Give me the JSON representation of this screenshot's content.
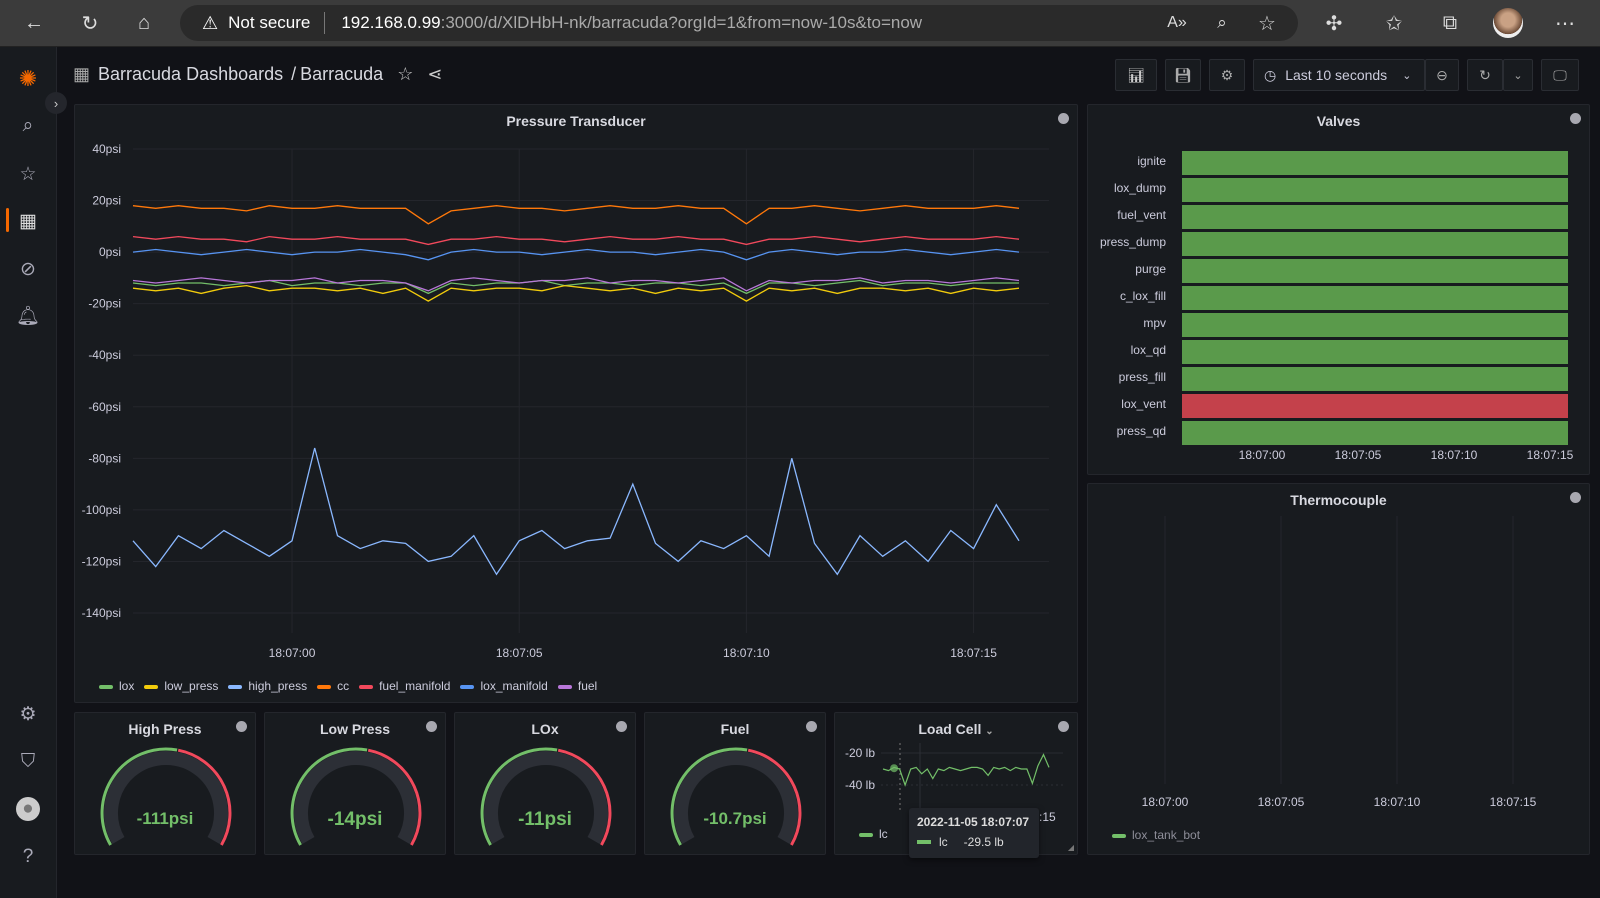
{
  "browser": {
    "security": "Not secure",
    "url_host": "192.168.0.99",
    "url_path": ":3000/d/XlDHbH-nk/barracuda?orgId=1&from=now-10s&to=now"
  },
  "nav": {
    "breadcrumb_folder": "Barracuda Dashboards",
    "breadcrumb_sep": "/",
    "dashboard": "Barracuda",
    "time_range": "Last 10 seconds"
  },
  "colors": {
    "lox": "#73bf69",
    "low_press": "#f2cc0c",
    "high_press": "#8ab8ff",
    "cc": "#ff780a",
    "fuel_manifold": "#f2495c",
    "lox_manifold": "#5794f2",
    "fuel": "#b877d9",
    "valve_open": "#5a9a4b",
    "valve_closed": "#c4414b"
  },
  "pressure": {
    "title": "Pressure Transducer",
    "chart_data": {
      "type": "line",
      "ylim": [
        -140,
        40
      ],
      "yticks": [
        "40psi",
        "20psi",
        "0psi",
        "-20psi",
        "-40psi",
        "-60psi",
        "-80psi",
        "-100psi",
        "-120psi",
        "-140psi"
      ],
      "xticks": [
        "18:07:00",
        "18:07:05",
        "18:07:10",
        "18:07:15"
      ],
      "x": [
        "18:06:56.5",
        "18:06:57.0",
        "18:06:57.5",
        "18:06:58.0",
        "18:06:58.5",
        "18:06:59.0",
        "18:06:59.5",
        "18:07:00.0",
        "18:07:00.5",
        "18:07:01.0",
        "18:07:01.5",
        "18:07:02.0",
        "18:07:02.5",
        "18:07:03.0",
        "18:07:03.5",
        "18:07:04.0",
        "18:07:04.5",
        "18:07:05.0",
        "18:07:05.5",
        "18:07:06.0",
        "18:07:06.5",
        "18:07:07.0",
        "18:07:07.5",
        "18:07:08.0",
        "18:07:08.5",
        "18:07:09.0",
        "18:07:09.5",
        "18:07:10.0",
        "18:07:10.5",
        "18:07:11.0",
        "18:07:11.5",
        "18:07:12.0",
        "18:07:12.5",
        "18:07:13.0",
        "18:07:13.5",
        "18:07:14.0",
        "18:07:14.5",
        "18:07:15.0",
        "18:07:15.5",
        "18:07:16.0"
      ],
      "series": [
        {
          "name": "lox",
          "values": [
            -12,
            -13,
            -12,
            -12,
            -13,
            -12,
            -11,
            -13,
            -12,
            -12,
            -13,
            -12,
            -12,
            -16,
            -12,
            -13,
            -12,
            -12,
            -11,
            -13,
            -12,
            -12,
            -13,
            -12,
            -12,
            -13,
            -12,
            -16,
            -12,
            -12,
            -13,
            -12,
            -11,
            -13,
            -12,
            -12,
            -13,
            -12,
            -12,
            -12
          ]
        },
        {
          "name": "low_press",
          "values": [
            -14,
            -15,
            -14,
            -16,
            -14,
            -13,
            -15,
            -14,
            -14,
            -15,
            -14,
            -16,
            -14,
            -19,
            -14,
            -15,
            -14,
            -14,
            -15,
            -13,
            -14,
            -15,
            -14,
            -16,
            -14,
            -15,
            -14,
            -19,
            -14,
            -15,
            -14,
            -16,
            -14,
            -14,
            -15,
            -14,
            -16,
            -14,
            -15,
            -14
          ]
        },
        {
          "name": "high_press",
          "values": [
            -112,
            -122,
            -110,
            -115,
            -108,
            -113,
            -118,
            -112,
            -76,
            -110,
            -115,
            -112,
            -113,
            -120,
            -118,
            -110,
            -125,
            -112,
            -108,
            -115,
            -112,
            -111,
            -90,
            -113,
            -120,
            -112,
            -115,
            -110,
            -118,
            -80,
            -113,
            -125,
            -110,
            -118,
            -112,
            -120,
            -108,
            -115,
            -98,
            -112
          ]
        },
        {
          "name": "cc",
          "values": [
            18,
            17,
            18,
            17,
            17,
            16,
            18,
            17,
            17,
            18,
            17,
            17,
            17,
            11,
            16,
            17,
            18,
            17,
            17,
            16,
            17,
            18,
            17,
            17,
            18,
            17,
            17,
            11,
            17,
            17,
            18,
            17,
            16,
            17,
            18,
            17,
            17,
            17,
            18,
            17
          ]
        },
        {
          "name": "fuel_manifold",
          "values": [
            6,
            5,
            6,
            5,
            5,
            4,
            6,
            5,
            5,
            6,
            5,
            5,
            5,
            3,
            5,
            5,
            6,
            5,
            5,
            4,
            5,
            6,
            5,
            5,
            6,
            5,
            5,
            3,
            5,
            5,
            6,
            5,
            4,
            5,
            6,
            5,
            5,
            5,
            6,
            5
          ]
        },
        {
          "name": "lox_manifold",
          "values": [
            0,
            1,
            0,
            -1,
            0,
            1,
            0,
            -1,
            0,
            0,
            1,
            0,
            -1,
            -3,
            0,
            1,
            0,
            0,
            -1,
            0,
            1,
            0,
            0,
            -1,
            0,
            1,
            0,
            -3,
            0,
            1,
            0,
            -1,
            0,
            0,
            1,
            0,
            -1,
            0,
            1,
            0
          ]
        },
        {
          "name": "fuel",
          "values": [
            -11,
            -12,
            -11,
            -10,
            -11,
            -12,
            -11,
            -11,
            -10,
            -12,
            -11,
            -11,
            -12,
            -15,
            -11,
            -10,
            -11,
            -12,
            -11,
            -11,
            -10,
            -12,
            -11,
            -11,
            -12,
            -11,
            -10,
            -15,
            -11,
            -12,
            -11,
            -11,
            -10,
            -12,
            -11,
            -11,
            -12,
            -11,
            -10,
            -11
          ]
        }
      ]
    }
  },
  "valves": {
    "title": "Valves",
    "chart_data": {
      "type": "state-timeline",
      "xticks": [
        "18:07:00",
        "18:07:05",
        "18:07:10",
        "18:07:15"
      ],
      "rows": [
        {
          "name": "ignite",
          "state": "open"
        },
        {
          "name": "lox_dump",
          "state": "open"
        },
        {
          "name": "fuel_vent",
          "state": "open"
        },
        {
          "name": "press_dump",
          "state": "open"
        },
        {
          "name": "purge",
          "state": "open"
        },
        {
          "name": "c_lox_fill",
          "state": "open"
        },
        {
          "name": "mpv",
          "state": "open"
        },
        {
          "name": "lox_qd",
          "state": "open"
        },
        {
          "name": "press_fill",
          "state": "open"
        },
        {
          "name": "lox_vent",
          "state": "closed"
        },
        {
          "name": "press_qd",
          "state": "open"
        }
      ]
    }
  },
  "thermocouple": {
    "title": "Thermocouple",
    "xticks": [
      "18:07:00",
      "18:07:05",
      "18:07:10",
      "18:07:15"
    ],
    "legend": "lox_tank_bot"
  },
  "gauges": [
    {
      "title": "High Press",
      "value": "-111psi"
    },
    {
      "title": "Low Press",
      "value": "-14psi"
    },
    {
      "title": "LOx",
      "value": "-11psi"
    },
    {
      "title": "Fuel",
      "value": "-10.7psi"
    }
  ],
  "loadcell": {
    "title": "Load Cell",
    "yticks": [
      "-20 lb",
      "-40 lb"
    ],
    "xtick_partial": ":15",
    "legend": "lc",
    "chart_data": {
      "type": "line",
      "ylim": [
        -45,
        -15
      ],
      "series": [
        {
          "name": "lc",
          "values": [
            -30,
            -31,
            -29,
            -30,
            -40,
            -30,
            -29,
            -33,
            -30,
            -36,
            -30,
            -31,
            -29,
            -30,
            -31,
            -30,
            -29,
            -29,
            -30,
            -34,
            -29,
            -30,
            -29,
            -31,
            -29,
            -30,
            -30,
            -39,
            -28,
            -21,
            -29
          ]
        }
      ]
    },
    "tooltip": {
      "time": "2022-11-05 18:07:07",
      "series": "lc",
      "value": "-29.5 lb"
    }
  }
}
